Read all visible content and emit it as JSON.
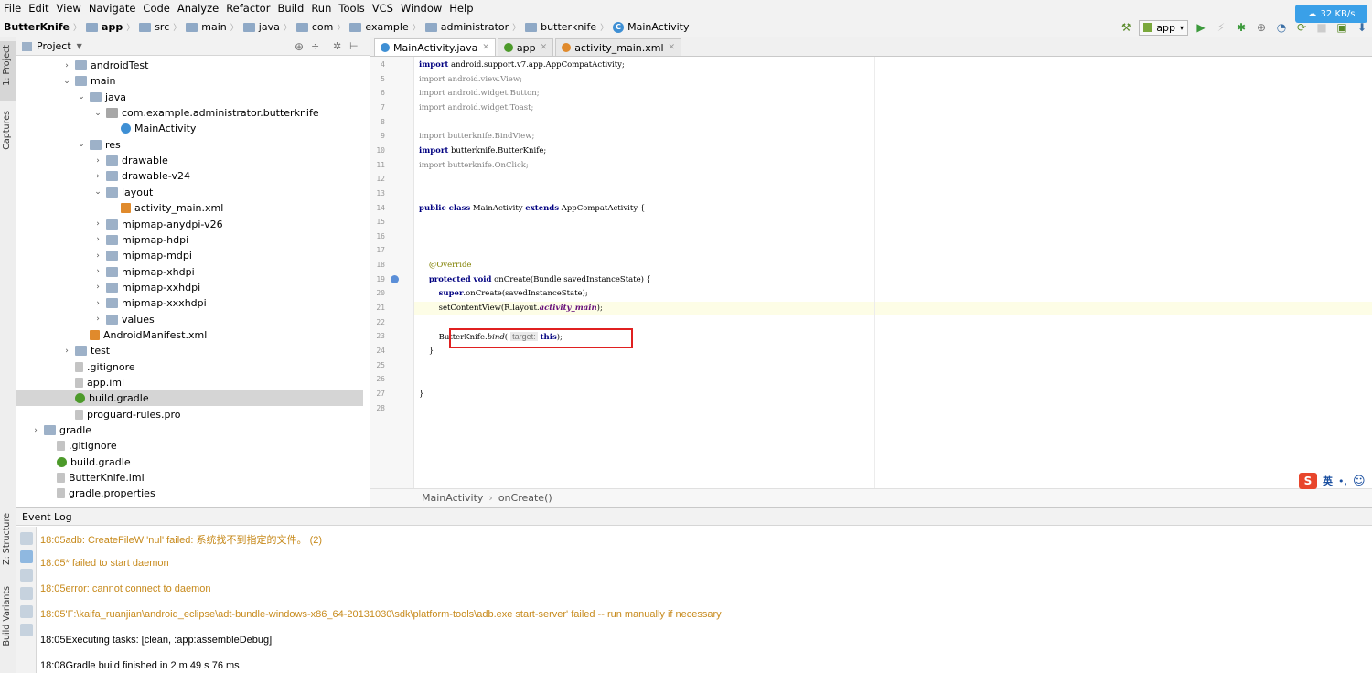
{
  "menu": [
    "File",
    "Edit",
    "View",
    "Navigate",
    "Code",
    "Analyze",
    "Refactor",
    "Build",
    "Run",
    "Tools",
    "VCS",
    "Window",
    "Help"
  ],
  "breadcrumbs": [
    "ButterKnife",
    "app",
    "src",
    "main",
    "java",
    "com",
    "example",
    "administrator",
    "butterknife",
    "MainActivity"
  ],
  "toolbar": {
    "config": "app",
    "net_speed": "32 KB/s"
  },
  "side_tabs": {
    "project": "1: Project",
    "captures": "Captures",
    "structure": "Z: Structure",
    "build_variants": "Build Variants"
  },
  "project_panel": {
    "title": "Project",
    "tree": [
      {
        "label": "androidTest",
        "type": "folder",
        "depth": 3,
        "arrow": "right"
      },
      {
        "label": "main",
        "type": "folder",
        "depth": 3,
        "arrow": "down"
      },
      {
        "label": "java",
        "type": "folder",
        "depth": 4,
        "arrow": "down"
      },
      {
        "label": "com.example.administrator.butterknife",
        "type": "pkg",
        "depth": 5,
        "arrow": "down"
      },
      {
        "label": "MainActivity",
        "type": "cls",
        "depth": 6,
        "arrow": ""
      },
      {
        "label": "res",
        "type": "folder",
        "depth": 4,
        "arrow": "down"
      },
      {
        "label": "drawable",
        "type": "folder",
        "depth": 5,
        "arrow": "right"
      },
      {
        "label": "drawable-v24",
        "type": "folder",
        "depth": 5,
        "arrow": "right"
      },
      {
        "label": "layout",
        "type": "folder",
        "depth": 5,
        "arrow": "down"
      },
      {
        "label": "activity_main.xml",
        "type": "xml",
        "depth": 6,
        "arrow": ""
      },
      {
        "label": "mipmap-anydpi-v26",
        "type": "folder",
        "depth": 5,
        "arrow": "right"
      },
      {
        "label": "mipmap-hdpi",
        "type": "folder",
        "depth": 5,
        "arrow": "right"
      },
      {
        "label": "mipmap-mdpi",
        "type": "folder",
        "depth": 5,
        "arrow": "right"
      },
      {
        "label": "mipmap-xhdpi",
        "type": "folder",
        "depth": 5,
        "arrow": "right"
      },
      {
        "label": "mipmap-xxhdpi",
        "type": "folder",
        "depth": 5,
        "arrow": "right"
      },
      {
        "label": "mipmap-xxxhdpi",
        "type": "folder",
        "depth": 5,
        "arrow": "right"
      },
      {
        "label": "values",
        "type": "folder",
        "depth": 5,
        "arrow": "right"
      },
      {
        "label": "AndroidManifest.xml",
        "type": "xml",
        "depth": 4,
        "arrow": ""
      },
      {
        "label": "test",
        "type": "folder",
        "depth": 3,
        "arrow": "right"
      },
      {
        "label": ".gitignore",
        "type": "file",
        "depth": 3,
        "arrow": ""
      },
      {
        "label": "app.iml",
        "type": "file",
        "depth": 3,
        "arrow": ""
      },
      {
        "label": "build.gradle",
        "type": "gradle",
        "depth": 3,
        "arrow": "",
        "selected": true
      },
      {
        "label": "proguard-rules.pro",
        "type": "file",
        "depth": 3,
        "arrow": ""
      },
      {
        "label": "gradle",
        "type": "folder",
        "depth": 1,
        "arrow": "right"
      },
      {
        "label": ".gitignore",
        "type": "file",
        "depth": 2,
        "arrow": ""
      },
      {
        "label": "build.gradle",
        "type": "gradle",
        "depth": 2,
        "arrow": ""
      },
      {
        "label": "ButterKnife.iml",
        "type": "file",
        "depth": 2,
        "arrow": ""
      },
      {
        "label": "gradle.properties",
        "type": "file",
        "depth": 2,
        "arrow": ""
      }
    ]
  },
  "editor_tabs": [
    {
      "label": "MainActivity.java",
      "active": true
    },
    {
      "label": "app",
      "active": false
    },
    {
      "label": "activity_main.xml",
      "active": false
    }
  ],
  "editor": {
    "lines": [
      {
        "n": "4",
        "html": "<span class='kw'>import</span> android.support.v7.app.AppCompatActivity;"
      },
      {
        "n": "5",
        "html": "<span class='kw gr' style='font-weight:normal'>import</span><span class='gr'> android.view.View;</span>"
      },
      {
        "n": "6",
        "html": "<span class='gr'>import android.widget.Button;</span>"
      },
      {
        "n": "7",
        "html": "<span class='gr'>import android.widget.Toast;</span>"
      },
      {
        "n": "8",
        "html": ""
      },
      {
        "n": "9",
        "html": "<span class='gr'>import butterknife.BindView;</span>"
      },
      {
        "n": "10",
        "html": "<span class='kw'>import</span> butterknife.ButterKnife;"
      },
      {
        "n": "11",
        "html": "<span class='gr'>import butterknife.OnClick;</span>"
      },
      {
        "n": "12",
        "html": ""
      },
      {
        "n": "13",
        "html": ""
      },
      {
        "n": "14",
        "html": "<span class='kw'>public class</span> MainActivity <span class='kw'>extends</span> AppCompatActivity {"
      },
      {
        "n": "15",
        "html": ""
      },
      {
        "n": "16",
        "html": ""
      },
      {
        "n": "17",
        "html": ""
      },
      {
        "n": "18",
        "html": "    <span class='an'>@Override</span>"
      },
      {
        "n": "19",
        "html": "    <span class='kw'>protected void</span> onCreate(Bundle savedInstanceState) {"
      },
      {
        "n": "20",
        "html": "        <span class='kw'>super</span>.onCreate(savedInstanceState);"
      },
      {
        "n": "21",
        "html": "        setContentView(R.layout.<span class='it'>activity_main</span>);"
      },
      {
        "n": "22",
        "html": ""
      },
      {
        "n": "23",
        "html": "        ButterKnife.<span class='mthd'>bind</span>(<span class='hint'>target:</span><span class='kw'>this</span>);"
      },
      {
        "n": "24",
        "html": "    }"
      },
      {
        "n": "25",
        "html": ""
      },
      {
        "n": "26",
        "html": ""
      },
      {
        "n": "27",
        "html": "}"
      },
      {
        "n": "28",
        "html": ""
      }
    ],
    "breadcrumb": [
      "MainActivity",
      "onCreate()"
    ]
  },
  "event_log": {
    "title": "Event Log",
    "entries": [
      {
        "time": "18:05",
        "text": "adb: CreateFileW 'nul' failed: 系统找不到指定的文件。 (2)",
        "level": "warn"
      },
      {
        "time": "18:05",
        "text": "* failed to start daemon",
        "level": "warn"
      },
      {
        "time": "18:05",
        "text": "error: cannot connect to daemon",
        "level": "warn"
      },
      {
        "time": "18:05",
        "text": "'F:\\kaifa_ruanjian\\android_eclipse\\adt-bundle-windows-x86_64-20131030\\sdk\\platform-tools\\adb.exe start-server' failed -- run manually if necessary",
        "level": "warn"
      },
      {
        "time": "18:05",
        "text": "Executing tasks: [clean, :app:assembleDebug]",
        "level": "norm"
      },
      {
        "time": "18:08",
        "text": "Gradle build finished in 2 m 49 s 76 ms",
        "level": "norm"
      }
    ]
  },
  "ime": {
    "lang": "英"
  }
}
